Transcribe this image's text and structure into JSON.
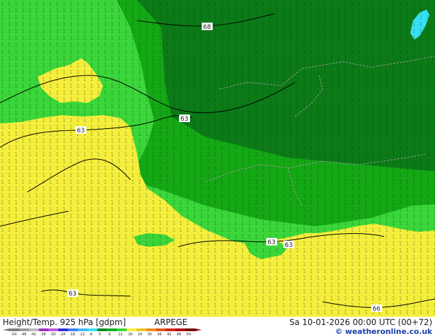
{
  "map": {
    "contour_labels": [
      "68",
      "63",
      "63",
      "63",
      "63",
      "63",
      "66"
    ],
    "colors": {
      "yellow": "#f5ee3c",
      "light_green": "#3ad63a",
      "mid_green": "#14a814",
      "dark_green": "#0b7a17",
      "cyan": "#36e0f4",
      "contour": "#000000",
      "border": "#9a9a9a"
    }
  },
  "footer": {
    "title": "Height/Temp. 925 hPa [gdpm]",
    "model": "ARPEGE",
    "valid_time": "Sa 10-01-2026 00:00 UTC (00+72)",
    "credit": "© weatheronline.co.uk",
    "scale_ticks": [
      "-54",
      "-48",
      "-42",
      "-38",
      "-30",
      "-24",
      "-18",
      "-12",
      "-6",
      "0",
      "6",
      "12",
      "18",
      "24",
      "30",
      "36",
      "42",
      "48",
      "54"
    ],
    "scale_colors": [
      "#7d7d7d",
      "#9a9a9a",
      "#b9b9b9",
      "#9b2fc2",
      "#c255e0",
      "#2d2dd8",
      "#3f7ff0",
      "#44b8f4",
      "#38e2f2",
      "#078a2d",
      "#12b21e",
      "#3ad63a",
      "#f5ee3c",
      "#f2c225",
      "#ee8e1a",
      "#e4561a",
      "#d42416",
      "#b50f14",
      "#7a0a0a"
    ]
  }
}
